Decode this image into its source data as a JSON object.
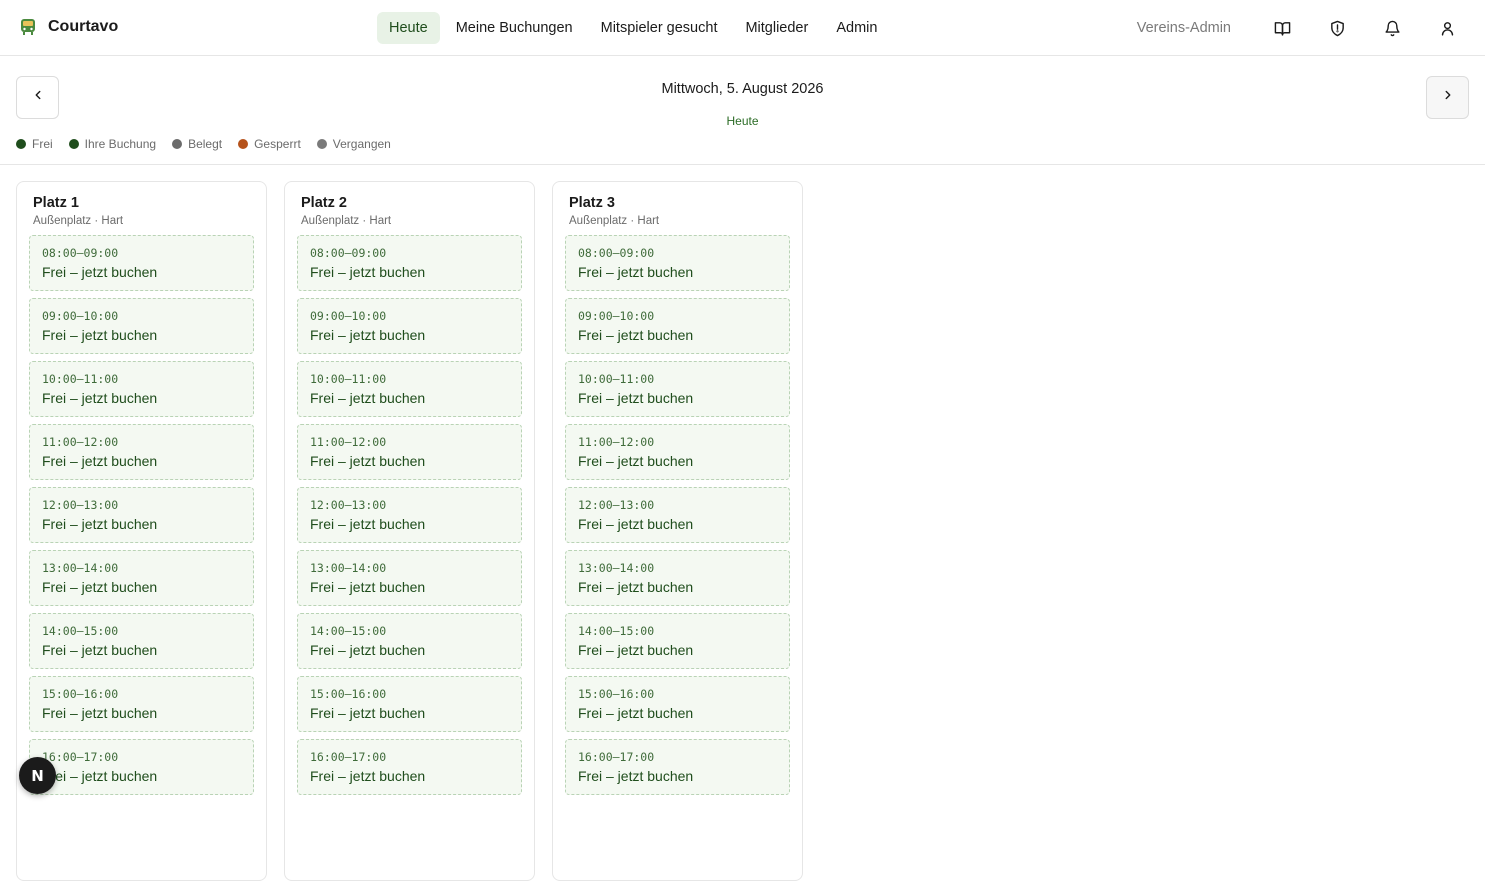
{
  "app": {
    "name": "Courtavo",
    "logo_icon": "tram-icon",
    "accent": "#2a6b25"
  },
  "nav": {
    "items": [
      {
        "label": "Heute",
        "active": true
      },
      {
        "label": "Meine Buchungen",
        "active": false
      },
      {
        "label": "Mitspieler gesucht",
        "active": false
      },
      {
        "label": "Mitglieder",
        "active": false
      },
      {
        "label": "Admin",
        "active": false
      }
    ]
  },
  "header_right": {
    "role": "Vereins-Admin",
    "icons": [
      "book-icon",
      "shield-icon",
      "bell-icon",
      "user-icon"
    ]
  },
  "datebar": {
    "prev_icon": "chevron-left-icon",
    "next_icon": "chevron-right-icon",
    "date": "Mittwoch, 5. August 2026",
    "today": "Heute"
  },
  "legend": [
    {
      "label": "Frei",
      "color": "#1f4d1c"
    },
    {
      "label": "Ihre Buchung",
      "color": "#1f4d1c"
    },
    {
      "label": "Belegt",
      "color": "#6b6b6b"
    },
    {
      "label": "Gesperrt",
      "color": "#b5521b"
    },
    {
      "label": "Vergangen",
      "color": "#7a7a7a"
    }
  ],
  "courts": [
    {
      "name": "Platz 1",
      "sub": "Außenplatz · Hart",
      "slots": [
        {
          "time": "08:00–09:00",
          "label": "Frei – jetzt buchen"
        },
        {
          "time": "09:00–10:00",
          "label": "Frei – jetzt buchen"
        },
        {
          "time": "10:00–11:00",
          "label": "Frei – jetzt buchen"
        },
        {
          "time": "11:00–12:00",
          "label": "Frei – jetzt buchen"
        },
        {
          "time": "12:00–13:00",
          "label": "Frei – jetzt buchen"
        },
        {
          "time": "13:00–14:00",
          "label": "Frei – jetzt buchen"
        },
        {
          "time": "14:00–15:00",
          "label": "Frei – jetzt buchen"
        },
        {
          "time": "15:00–16:00",
          "label": "Frei – jetzt buchen"
        },
        {
          "time": "16:00–17:00",
          "label": "Frei – jetzt buchen"
        }
      ]
    },
    {
      "name": "Platz 2",
      "sub": "Außenplatz · Hart",
      "slots": [
        {
          "time": "08:00–09:00",
          "label": "Frei – jetzt buchen"
        },
        {
          "time": "09:00–10:00",
          "label": "Frei – jetzt buchen"
        },
        {
          "time": "10:00–11:00",
          "label": "Frei – jetzt buchen"
        },
        {
          "time": "11:00–12:00",
          "label": "Frei – jetzt buchen"
        },
        {
          "time": "12:00–13:00",
          "label": "Frei – jetzt buchen"
        },
        {
          "time": "13:00–14:00",
          "label": "Frei – jetzt buchen"
        },
        {
          "time": "14:00–15:00",
          "label": "Frei – jetzt buchen"
        },
        {
          "time": "15:00–16:00",
          "label": "Frei – jetzt buchen"
        },
        {
          "time": "16:00–17:00",
          "label": "Frei – jetzt buchen"
        }
      ]
    },
    {
      "name": "Platz 3",
      "sub": "Außenplatz · Hart",
      "slots": [
        {
          "time": "08:00–09:00",
          "label": "Frei – jetzt buchen"
        },
        {
          "time": "09:00–10:00",
          "label": "Frei – jetzt buchen"
        },
        {
          "time": "10:00–11:00",
          "label": "Frei – jetzt buchen"
        },
        {
          "time": "11:00–12:00",
          "label": "Frei – jetzt buchen"
        },
        {
          "time": "12:00–13:00",
          "label": "Frei – jetzt buchen"
        },
        {
          "time": "13:00–14:00",
          "label": "Frei – jetzt buchen"
        },
        {
          "time": "14:00–15:00",
          "label": "Frei – jetzt buchen"
        },
        {
          "time": "15:00–16:00",
          "label": "Frei – jetzt buchen"
        },
        {
          "time": "16:00–17:00",
          "label": "Frei – jetzt buchen"
        }
      ]
    }
  ],
  "fab": {
    "label": "N",
    "icon": "nextjs-badge-icon"
  }
}
